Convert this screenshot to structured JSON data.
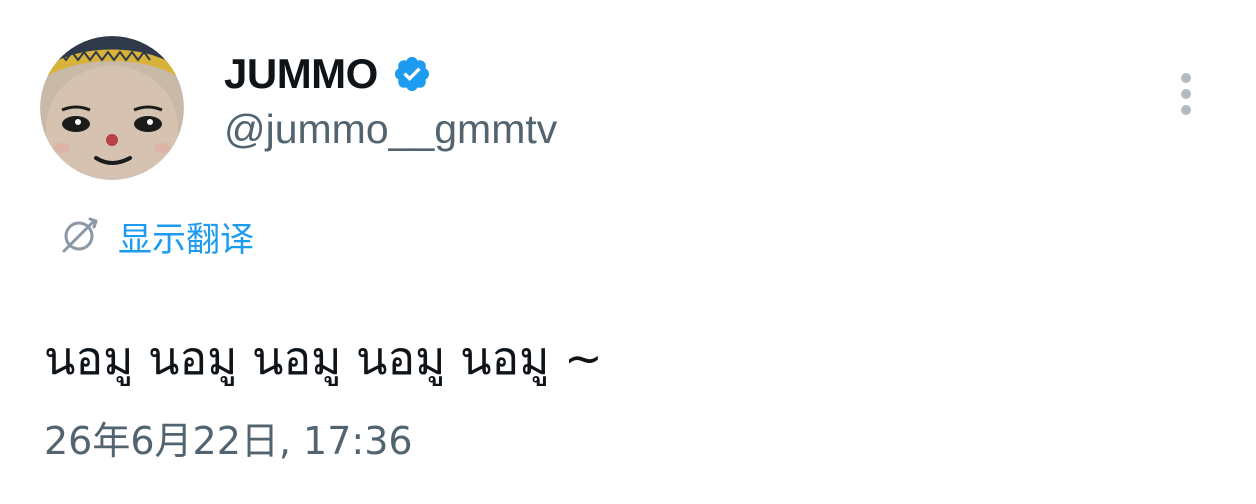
{
  "author": {
    "display_name": "JUMMO",
    "handle": "@jummo__gmmtv",
    "verified": true,
    "avatar_icon": "mascot-avatar"
  },
  "actions": {
    "more_icon": "more-vertical-icon"
  },
  "translate": {
    "icon": "translate-globe-icon",
    "label": "显示翻译"
  },
  "tweet": {
    "text": "นอมู นอมู นอมู นอมู นอมู ~",
    "timestamp": "26年6月22日, 17:36"
  },
  "colors": {
    "link_blue": "#1d9bf0",
    "secondary_text": "#536471",
    "primary_text": "#0f1419",
    "verified_blue": "#1d9bf0"
  }
}
